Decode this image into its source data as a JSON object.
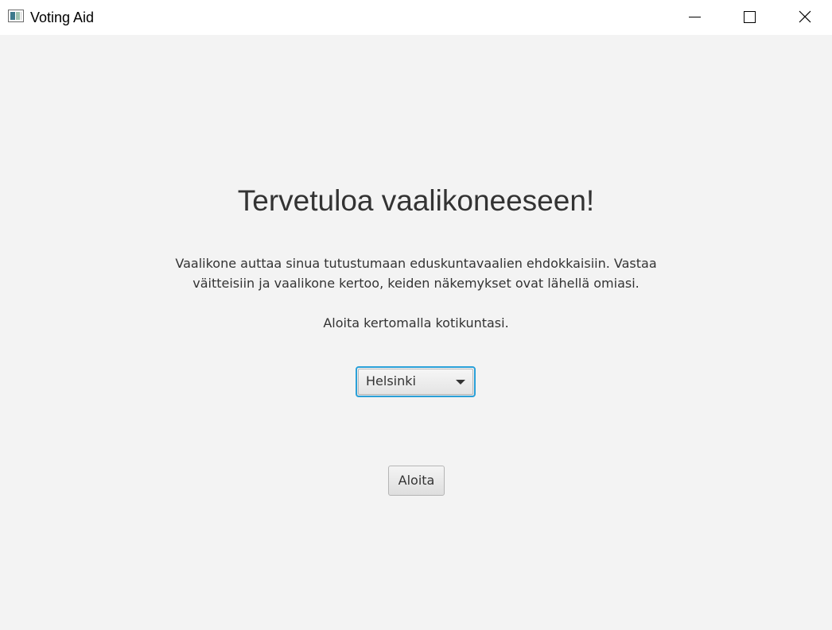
{
  "window": {
    "title": "Voting Aid",
    "icon": "app-icon",
    "controls": [
      "minimize-icon",
      "maximize-icon",
      "close-icon"
    ]
  },
  "main": {
    "heading": "Tervetuloa vaalikoneeseen!",
    "intro": "Vaalikone auttaa sinua tutustumaan eduskuntavaalien ehdokkaisiin. Vastaa väitteisiin ja vaalikone kertoo, keiden näkemykset ovat lähellä omiasi.",
    "prompt": "Aloita kertomalla kotikuntasi.",
    "municipality_select": {
      "selected": "Helsinki"
    },
    "start_button_label": "Aloita"
  },
  "colors": {
    "background": "#f3f3f3",
    "focus_border": "#2aa0d8",
    "text": "#333333"
  }
}
